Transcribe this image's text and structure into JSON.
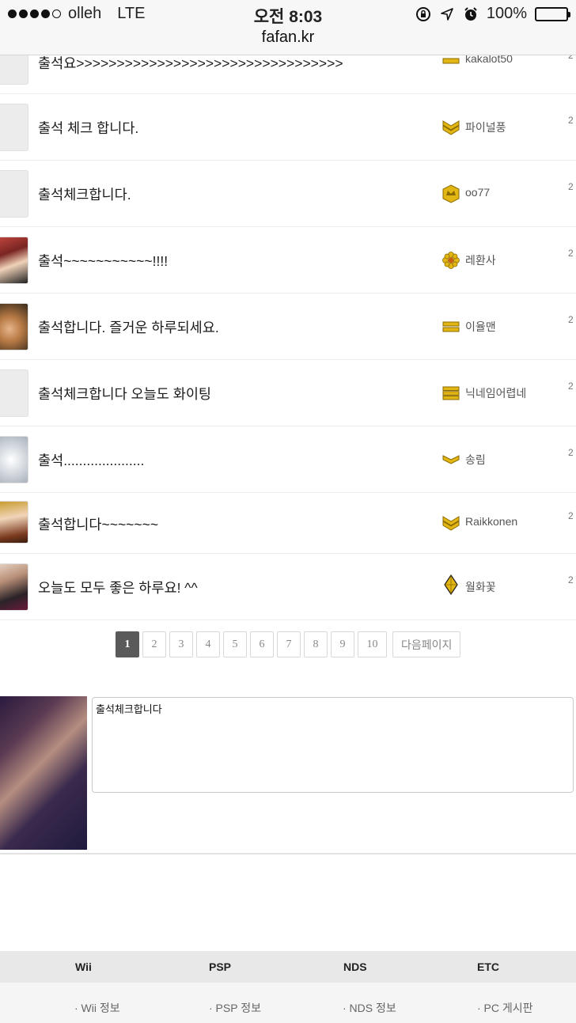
{
  "status_bar": {
    "carrier": "olleh",
    "network": "LTE",
    "time": "오전 8:03",
    "battery": "100%",
    "battery_level": 1.0,
    "url": "fafan.kr",
    "signal_bars_filled": 4,
    "signal_bars_total": 5
  },
  "rows": [
    {
      "title": "출석요>>>>>>>>>>>>>>>>>>>>>>>>>>>>>>>>>",
      "author": "kakalot50",
      "date": "2",
      "level_icon": "single-bar-rank-icon"
    },
    {
      "title": "출석 체크 합니다.",
      "author": "파이널풍",
      "date": "2",
      "level_icon": "triple-chevron-rank-icon"
    },
    {
      "title": "출석체크합니다.",
      "author": "oo77",
      "date": "2",
      "level_icon": "crown-badge-rank-icon"
    },
    {
      "title": "출석~~~~~~~~~~~!!!!",
      "author": "레환사",
      "date": "2",
      "level_icon": "flower-rank-icon"
    },
    {
      "title": "출석합니다. 즐거운 하루되세요.",
      "author": "이율맨",
      "date": "2",
      "level_icon": "double-bar-rank-icon"
    },
    {
      "title": "출석체크합니다 오늘도 화이팅",
      "author": "닉네임어렵네",
      "date": "2",
      "level_icon": "triple-bar-rank-icon"
    },
    {
      "title": "출석.....................",
      "author": "송림",
      "date": "2",
      "level_icon": "single-chevron-rank-icon"
    },
    {
      "title": "출석합니다~~~~~~~",
      "author": "Raikkonen",
      "date": "2",
      "level_icon": "triple-chevron-rank-icon"
    },
    {
      "title": "오늘도 모두 좋은 하루요! ^^",
      "author": "월화꽃",
      "date": "2",
      "level_icon": "diamond-rank-icon"
    }
  ],
  "pagination": {
    "pages": [
      "1",
      "2",
      "3",
      "4",
      "5",
      "6",
      "7",
      "8",
      "9",
      "10"
    ],
    "current": "1",
    "next_label": "다음페이지"
  },
  "comment": {
    "value": "출석체크합니다"
  },
  "footer": {
    "headers": [
      "Wii",
      "PSP",
      "NDS",
      "ETC"
    ],
    "links": [
      "· Wii 정보",
      "· PSP 정보",
      "· NDS 정보",
      "· PC 게시판"
    ]
  },
  "colors": {
    "rank_gold": "#e2b613",
    "rank_gold_dark": "#8a6a00",
    "active_page": "#5a5a5a"
  }
}
